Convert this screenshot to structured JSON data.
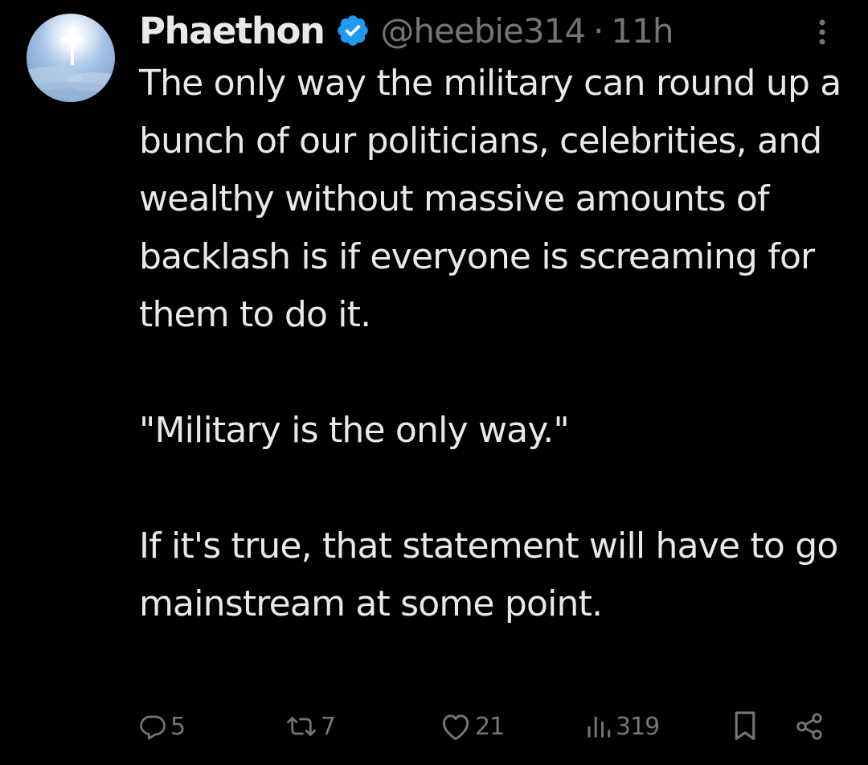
{
  "tweet": {
    "display_name": "Phaethon",
    "verified_icon": "verified-badge-icon",
    "handle": "@heebie314",
    "separator": "·",
    "time": "11h",
    "paragraphs": [
      "The only way the military can round up a bunch of our politicians, celebrities, and wealthy without massive amounts of backlash is if everyone is screaming for them to do it.",
      "\"Military is the only way.\"",
      "If it's true, that statement will have to go mainstream at some point."
    ]
  },
  "actions": {
    "replies": "5",
    "retweets": "7",
    "likes": "21",
    "views": "319"
  },
  "icons": {
    "avatar": "avatar-image",
    "more": "more-options-icon",
    "reply": "reply-icon",
    "retweet": "retweet-icon",
    "like": "heart-icon",
    "views": "views-icon",
    "bookmark": "bookmark-icon",
    "share": "share-icon"
  },
  "colors": {
    "background": "#000000",
    "text": "#e7e9ea",
    "secondary": "#71767b",
    "verified": "#1d9bf0"
  }
}
